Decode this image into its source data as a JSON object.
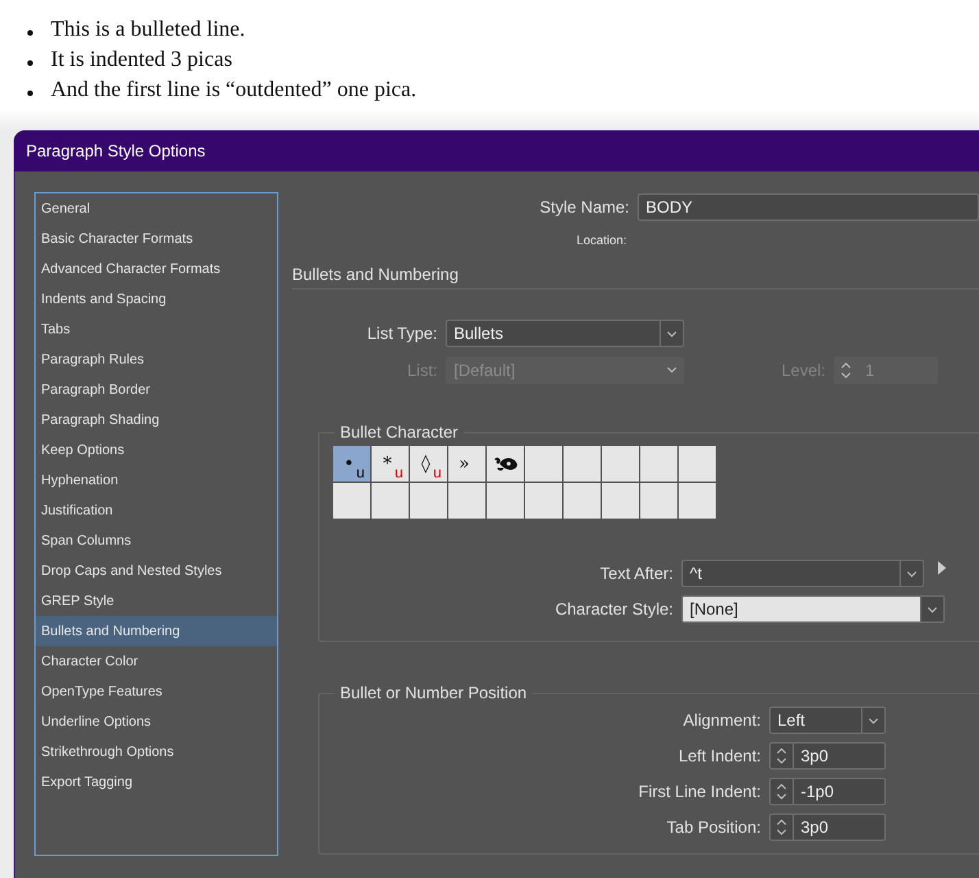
{
  "document": {
    "bullets": [
      "This is a bulleted line.",
      "It is indented 3 picas",
      "And the first line is “outdented” one pica."
    ]
  },
  "dialog": {
    "title": "Paragraph Style Options",
    "sidebar": {
      "items": [
        {
          "label": "General",
          "selected": false
        },
        {
          "label": "Basic Character Formats",
          "selected": false
        },
        {
          "label": "Advanced Character Formats",
          "selected": false
        },
        {
          "label": "Indents and Spacing",
          "selected": false
        },
        {
          "label": "Tabs",
          "selected": false
        },
        {
          "label": "Paragraph Rules",
          "selected": false
        },
        {
          "label": "Paragraph Border",
          "selected": false
        },
        {
          "label": "Paragraph Shading",
          "selected": false
        },
        {
          "label": "Keep Options",
          "selected": false
        },
        {
          "label": "Hyphenation",
          "selected": false
        },
        {
          "label": "Justification",
          "selected": false
        },
        {
          "label": "Span Columns",
          "selected": false
        },
        {
          "label": "Drop Caps and Nested Styles",
          "selected": false
        },
        {
          "label": "GREP Style",
          "selected": false
        },
        {
          "label": "Bullets and Numbering",
          "selected": true
        },
        {
          "label": "Character Color",
          "selected": false
        },
        {
          "label": "OpenType Features",
          "selected": false
        },
        {
          "label": "Underline Options",
          "selected": false
        },
        {
          "label": "Strikethrough Options",
          "selected": false
        },
        {
          "label": "Export Tagging",
          "selected": false
        }
      ]
    },
    "style_name": {
      "label": "Style Name:",
      "value": "BODY"
    },
    "location": {
      "label": "Location:"
    },
    "section_title": "Bullets and Numbering",
    "list_type": {
      "label": "List Type:",
      "value": "Bullets",
      "disabled": false
    },
    "list": {
      "label": "List:",
      "value": "[Default]",
      "disabled": true
    },
    "level": {
      "label": "Level:",
      "value": "1",
      "disabled": true
    },
    "bullet_character": {
      "title": "Bullet Character",
      "cells": [
        {
          "kind": "glyph",
          "glyph": "•",
          "flag": "u",
          "color": "#000000",
          "selected": true
        },
        {
          "kind": "glyph",
          "glyph": "*",
          "flag": "u",
          "color": "#e00000",
          "selected": false
        },
        {
          "kind": "glyph",
          "glyph": "◊",
          "flag": "u",
          "color": "#e00000",
          "selected": false
        },
        {
          "kind": "glyph",
          "glyph": "»",
          "selected": false
        },
        {
          "kind": "ornament",
          "selected": false
        },
        {
          "kind": "empty",
          "selected": false
        },
        {
          "kind": "empty",
          "selected": false
        },
        {
          "kind": "empty",
          "selected": false
        },
        {
          "kind": "empty",
          "selected": false
        },
        {
          "kind": "empty",
          "selected": false
        },
        {
          "kind": "empty",
          "selected": false
        },
        {
          "kind": "empty",
          "selected": false
        },
        {
          "kind": "empty",
          "selected": false
        },
        {
          "kind": "empty",
          "selected": false
        },
        {
          "kind": "empty",
          "selected": false
        },
        {
          "kind": "empty",
          "selected": false
        },
        {
          "kind": "empty",
          "selected": false
        },
        {
          "kind": "empty",
          "selected": false
        },
        {
          "kind": "empty",
          "selected": false
        },
        {
          "kind": "empty",
          "selected": false
        }
      ],
      "text_after": {
        "label": "Text After:",
        "value": "^t"
      },
      "character_style": {
        "label": "Character Style:",
        "value": "[None]"
      }
    },
    "position": {
      "title": "Bullet or Number Position",
      "fields": [
        {
          "kind": "dropdown",
          "label": "Alignment:",
          "value": "Left"
        },
        {
          "kind": "spinner",
          "label": "Left Indent:",
          "value": "3p0"
        },
        {
          "kind": "spinner",
          "label": "First Line Indent:",
          "value": "-1p0"
        },
        {
          "kind": "spinner",
          "label": "Tab Position:",
          "value": "3p0"
        }
      ]
    }
  }
}
